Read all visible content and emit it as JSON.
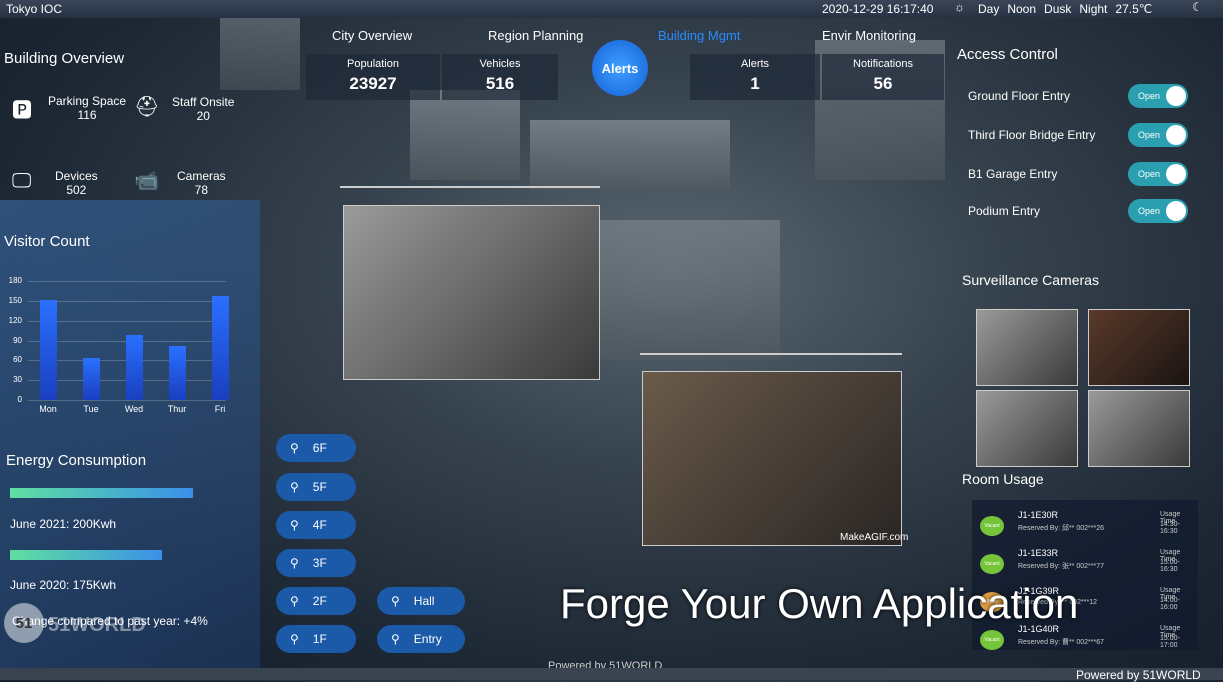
{
  "app_title": "Tokyo IOC",
  "datetime": "2020-12-29 16:17:40",
  "time_modes": [
    "Day",
    "Noon",
    "Dusk",
    "Night"
  ],
  "temperature": "27.5℃",
  "nav": [
    "City Overview",
    "Region Planning",
    "Building Mgmt",
    "Envir Monitoring"
  ],
  "stats": [
    {
      "label": "Population",
      "value": "23927"
    },
    {
      "label": "Vehicles",
      "value": "516"
    },
    {
      "label": "Alerts",
      "value": "1"
    },
    {
      "label": "Notifications",
      "value": "56"
    }
  ],
  "alerts_button": "Alerts",
  "building_overview": {
    "title": "Building Overview",
    "items": [
      {
        "label": "Parking Space",
        "value": "116",
        "icon": "car-icon"
      },
      {
        "label": "Staff Onsite",
        "value": "20",
        "icon": "staff-icon"
      },
      {
        "label": "Devices",
        "value": "502",
        "icon": "monitor-icon"
      },
      {
        "label": "Cameras",
        "value": "78",
        "icon": "camera-icon"
      }
    ]
  },
  "visitor_count": {
    "title": "Visitor Count"
  },
  "chart_data": {
    "type": "bar",
    "categories": [
      "Mon",
      "Tue",
      "Wed",
      "Thur",
      "Fri"
    ],
    "values": [
      152,
      64,
      99,
      81,
      157
    ],
    "yticks": [
      0,
      30,
      60,
      90,
      120,
      150,
      180
    ],
    "ylim": [
      0,
      180
    ],
    "grid": true
  },
  "energy": {
    "title": "Energy Consumption",
    "rows": [
      {
        "label": "June 2021: 200Kwh",
        "fraction": 1.0
      },
      {
        "label": "June 2020: 175Kwh",
        "fraction": 0.83
      }
    ],
    "compare": "Change compared to past year:  +4%"
  },
  "access_control": {
    "title": "Access Control",
    "items": [
      {
        "label": "Ground Floor Entry",
        "state": "Open"
      },
      {
        "label": "Third Floor Bridge Entry",
        "state": "Open"
      },
      {
        "label": "B1 Garage Entry",
        "state": "Open"
      },
      {
        "label": "Podium Entry",
        "state": "Open"
      }
    ]
  },
  "surveillance_title": "Surveillance Cameras",
  "room_usage": {
    "title": "Room Usage",
    "rooms": [
      {
        "name": "J1-1E30R",
        "reserved": "Reserved By: 邱**  002***26",
        "status": "Vacant",
        "usage_label": "Usage Time",
        "time": "14:30-16:30",
        "color": "#76c43a"
      },
      {
        "name": "J1-1E33R",
        "reserved": "Reserved By: 张**  002***77",
        "status": "Vacant",
        "usage_label": "Usage Time",
        "time": "15:00-16:30",
        "color": "#76c43a"
      },
      {
        "name": "J1-1G39R",
        "reserved": "Reserved By: **  002***12",
        "status": "Busy",
        "usage_label": "Usage Time",
        "time": "14:00-16:00",
        "color": "#e0a040"
      },
      {
        "name": "J1-1G40R",
        "reserved": "Reserved By: 曹**  002***67",
        "status": "Vacant",
        "usage_label": "Usage Time",
        "time": "15:00-17:00",
        "color": "#76c43a"
      }
    ]
  },
  "floors": [
    "6F",
    "5F",
    "4F",
    "3F",
    "2F",
    "1F"
  ],
  "zones": [
    "Hall",
    "Entry"
  ],
  "watermark_video": "MakeAGIF.com",
  "overlay_caption": "Forge Your Own Application",
  "logo": "51WORLD",
  "footer": "Powered by 51WORLD",
  "footer_center": "Powered by 51WORLD"
}
